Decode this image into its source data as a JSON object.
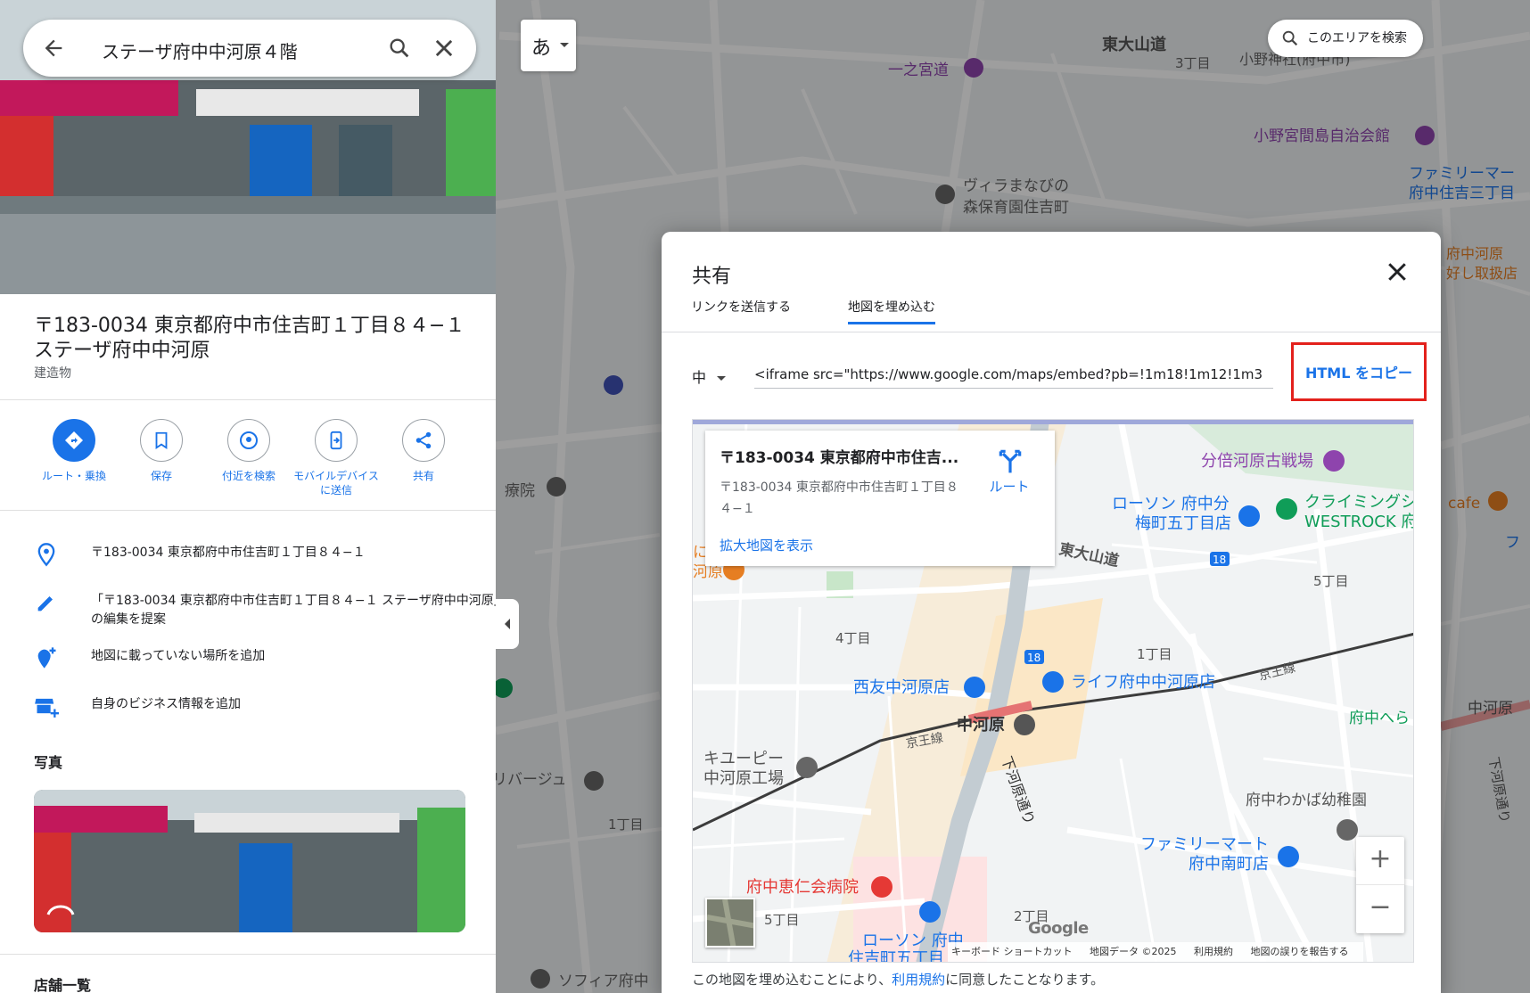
{
  "search": {
    "query": "ステーザ府中中河原４階"
  },
  "place": {
    "title": "〒183-0034 東京都府中市住吉町１丁目８４−１ ステーザ府中中河原",
    "type": "建造物"
  },
  "actions": [
    {
      "label": "ルート・乗換",
      "icon": "directions-icon"
    },
    {
      "label": "保存",
      "icon": "bookmark-icon"
    },
    {
      "label": "付近を検索",
      "icon": "nearby-icon"
    },
    {
      "label": "モバイルデバイスに送信",
      "icon": "send-to-phone-icon"
    },
    {
      "label": "共有",
      "icon": "share-icon"
    }
  ],
  "info_rows": [
    {
      "text": "〒183-0034 東京都府中市住吉町１丁目８４−１",
      "icon": "location-pin-icon"
    },
    {
      "text": "「〒183-0034 東京都府中市住吉町１丁目８４−１ ステーザ府中中河原」の編集を提案",
      "icon": "pencil-icon"
    },
    {
      "text": "地図に載っていない場所を追加",
      "icon": "add-place-icon"
    },
    {
      "text": "自身のビジネス情報を追加",
      "icon": "add-business-icon"
    }
  ],
  "photos_heading": "写真",
  "stores_heading": "店舗一覧",
  "map_top": {
    "ime_key": "あ",
    "area_search": "このエリアを検索"
  },
  "bg_labels": {
    "higashi_oyama": "東大山道",
    "ichinomiya": "一之宮道",
    "chome3": "3丁目",
    "ono_shrine": "小野神社(府中市)",
    "ono_hall": "小野宮間島自治会館",
    "villa": "ヴィラまなびの",
    "villa2": "森保育園住吉町",
    "family_top": "ファミリーマー",
    "family_top2": "府中住吉三丁目",
    "hoken": "府中河原",
    "hoken2": "好し取扱店",
    "riverside": "リバージュ",
    "sofia": "ソフィア府中",
    "chome1": "1丁目",
    "clinic": "療院",
    "cafe": "cafe",
    "nakagawara_r": "中河原",
    "shimokawara": "下河原通り",
    "keio_line": "京王線",
    "fu": "フ"
  },
  "dialog": {
    "title": "共有",
    "tabs": [
      "リンクを送信する",
      "地図を埋め込む"
    ],
    "active_tab": 1,
    "size": "中",
    "embed_code": "<iframe src=\"https://www.google.com/maps/embed?pb=!1m18!1m12!1m3",
    "copy_button": "HTML をコピー",
    "highlight_color": "#e3211c",
    "terms_prefix": "この地図を埋め込むことにより、",
    "terms_link": "利用規約",
    "terms_suffix": "に同意したことなります。"
  },
  "preview": {
    "card_title": "〒183-0034 東京都府中市住吉...",
    "card_address": "〒183-0034 東京都府中市住吉町１丁目８４−１",
    "route_label": "ルート",
    "larger_map": "拡大地図を表示",
    "labels": {
      "bunbai": "分倍河原古戦場",
      "lawson1": "ローソン 府中分",
      "lawson1b": "梅町五丁目店",
      "climbing": "クライミングシ",
      "climbing2": "WESTROCK 府",
      "higashi_oyama": "東大山道",
      "route18": "18",
      "chome5": "5丁目",
      "chome4": "4丁目",
      "chome1": "1丁目",
      "nishitomo": "西友中河原店",
      "life": "ライフ府中中河原店",
      "keio": "京王線",
      "keio2": "京王線",
      "nakagawara": "中河原",
      "fuchu_he": "府中へら",
      "kewpie": "キユーピー",
      "kewpie2": "中河原工場",
      "shimokawara": "下河原通り",
      "wakaba": "府中わかば幼稚園",
      "family": "ファミリーマート",
      "family2": "府中南町店",
      "jinkai": "府中恵仁会病院",
      "chome5b": "5丁目",
      "chome2": "2丁目",
      "lawson2": "ローソン 府中",
      "lawson2b": "住吉町五丁目",
      "ni": "に",
      "kawara": "河原"
    },
    "google_logo": "Google",
    "attribution": [
      "キーボード ショートカット",
      "地図データ ©2025",
      "利用規約",
      "地図の誤りを報告する"
    ]
  },
  "colors": {
    "accent": "#1a73e8",
    "poi_purple": "#8e44ad",
    "poi_blue": "#1a73e8",
    "poi_green": "#0f9d58",
    "poi_red": "#e53935"
  }
}
